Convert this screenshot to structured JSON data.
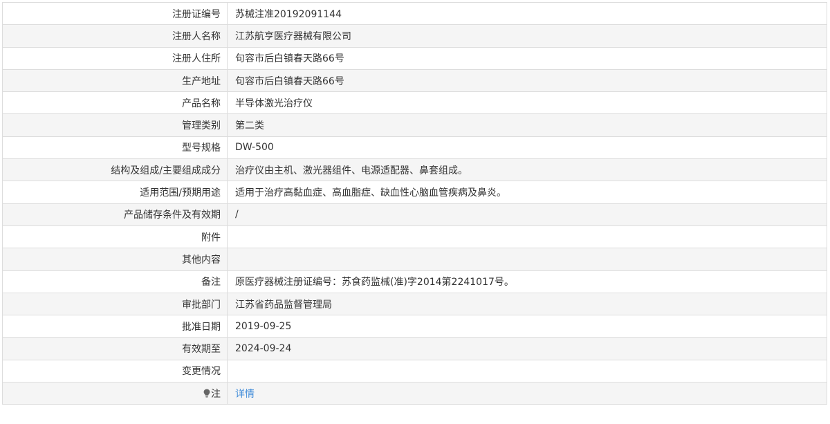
{
  "rows": [
    {
      "label": "注册证编号",
      "value": "苏械注准20192091144"
    },
    {
      "label": "注册人名称",
      "value": "江苏航亨医疗器械有限公司"
    },
    {
      "label": "注册人住所",
      "value": "句容市后白镇春天路66号"
    },
    {
      "label": "生产地址",
      "value": "句容市后白镇春天路66号"
    },
    {
      "label": "产品名称",
      "value": "半导体激光治疗仪"
    },
    {
      "label": "管理类别",
      "value": "第二类"
    },
    {
      "label": "型号规格",
      "value": "DW-500"
    },
    {
      "label": "结构及组成/主要组成成分",
      "value": "治疗仪由主机、激光器组件、电源适配器、鼻套组成。"
    },
    {
      "label": "适用范围/预期用途",
      "value": "适用于治疗高黏血症、高血脂症、缺血性心脑血管疾病及鼻炎。"
    },
    {
      "label": "产品储存条件及有效期",
      "value": "/"
    },
    {
      "label": "附件",
      "value": ""
    },
    {
      "label": "其他内容",
      "value": ""
    },
    {
      "label": "备注",
      "value": "原医疗器械注册证编号：苏食药监械(准)字2014第2241017号。"
    },
    {
      "label": "审批部门",
      "value": "江苏省药品监督管理局"
    },
    {
      "label": "批准日期",
      "value": "2019-09-25"
    },
    {
      "label": "有效期至",
      "value": "2024-09-24"
    },
    {
      "label": "变更情况",
      "value": ""
    }
  ],
  "note": {
    "icon": "lightbulb-icon",
    "label": "注",
    "link_text": "详情",
    "link_color": "#3f8bd9"
  },
  "colors": {
    "border": "#dddddd",
    "stripe": "#f5f5f5",
    "text": "#333333"
  }
}
